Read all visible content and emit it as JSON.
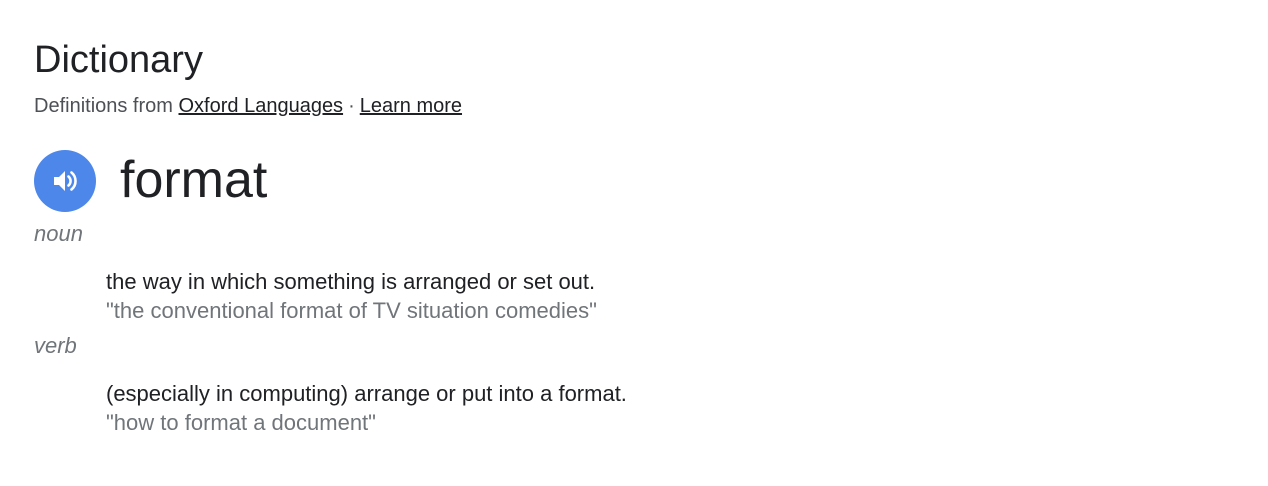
{
  "header": {
    "title": "Dictionary",
    "source_prefix": "Definitions from",
    "source_link": "Oxford Languages",
    "separator": "·",
    "learn_more": "Learn more"
  },
  "entry": {
    "word": "format",
    "pronounce_icon": "speaker-icon",
    "accent_color": "#4d87ea",
    "senses": [
      {
        "pos": "noun",
        "definition": "the way in which something is arranged or set out.",
        "example": "\"the conventional format of TV situation comedies\""
      },
      {
        "pos": "verb",
        "definition": "(especially in computing) arrange or put into a format.",
        "example": "\"how to format a document\""
      }
    ]
  }
}
